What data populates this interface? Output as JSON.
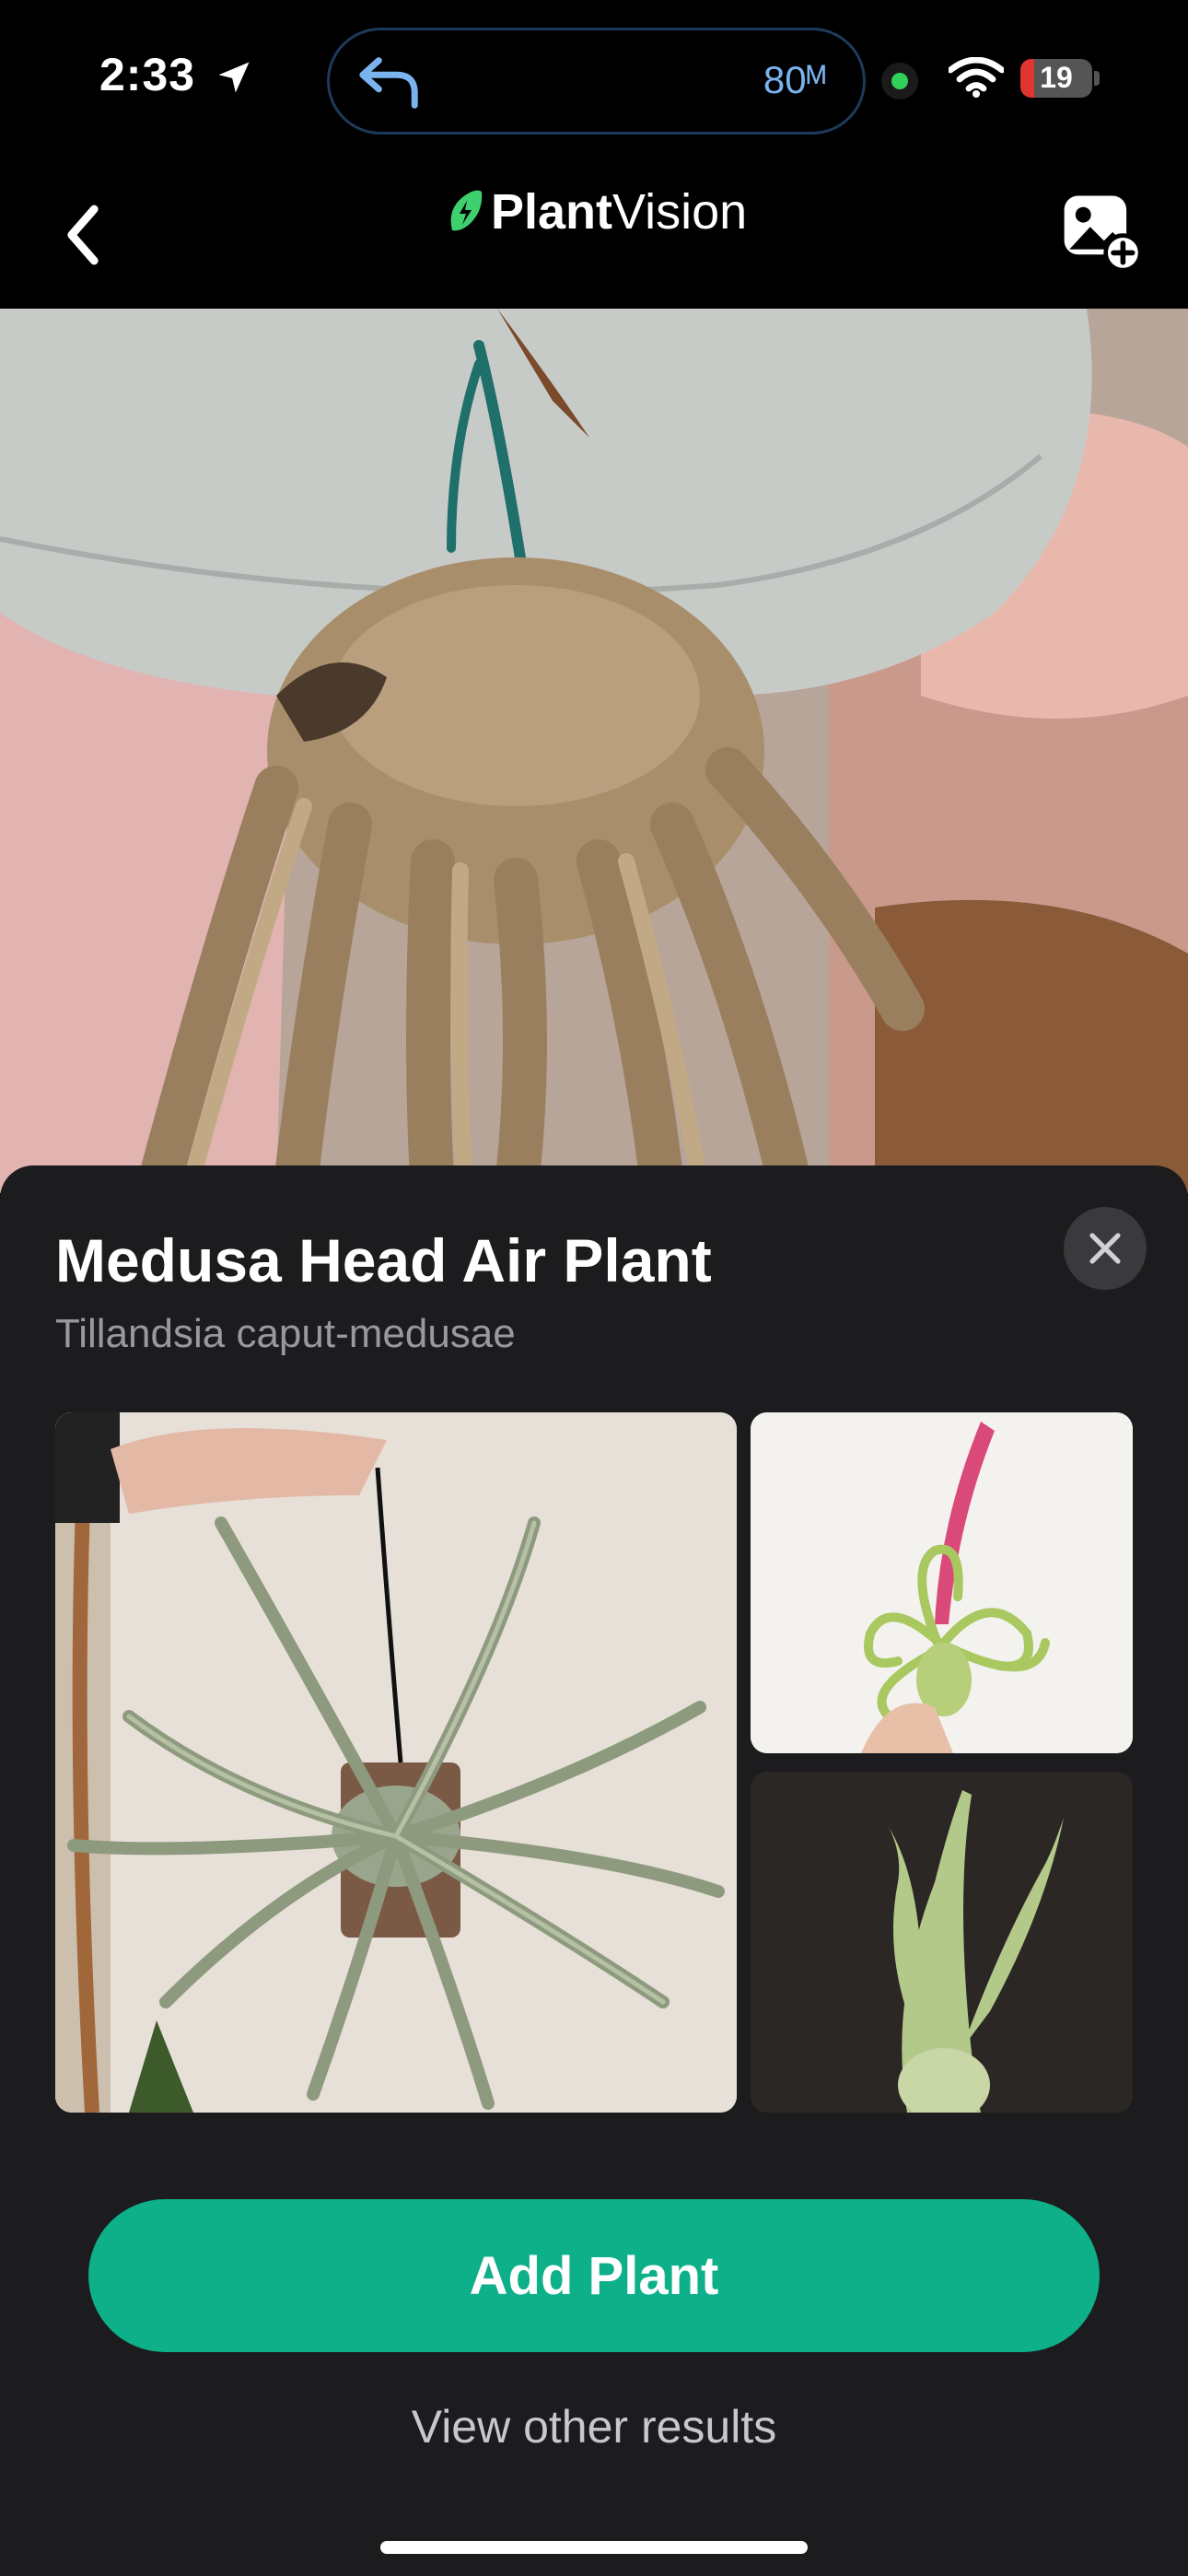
{
  "status_bar": {
    "time": "2:33",
    "navigation_distance": "80ᴹ",
    "battery_level": "19",
    "battery_fraction": 0.19,
    "icons": [
      "location-arrow-icon",
      "navigation-back-icon",
      "recording-dot-icon",
      "wifi-icon",
      "battery-icon"
    ]
  },
  "header": {
    "brand_part1": "Plant",
    "brand_part2": "Vision",
    "icons": [
      "chevron-left-icon",
      "leaf-bolt-logo-icon",
      "add-photo-icon"
    ]
  },
  "result": {
    "common_name": "Medusa Head Air Plant",
    "scientific_name": "Tillandsia caput-medusae"
  },
  "actions": {
    "add_plant_label": "Add Plant",
    "view_other_label": "View other results"
  },
  "colors": {
    "accent": "#0db088",
    "sheet_background": "#1c1c1e",
    "secondary_text": "#98989f",
    "island_text": "#7ab3ee"
  }
}
